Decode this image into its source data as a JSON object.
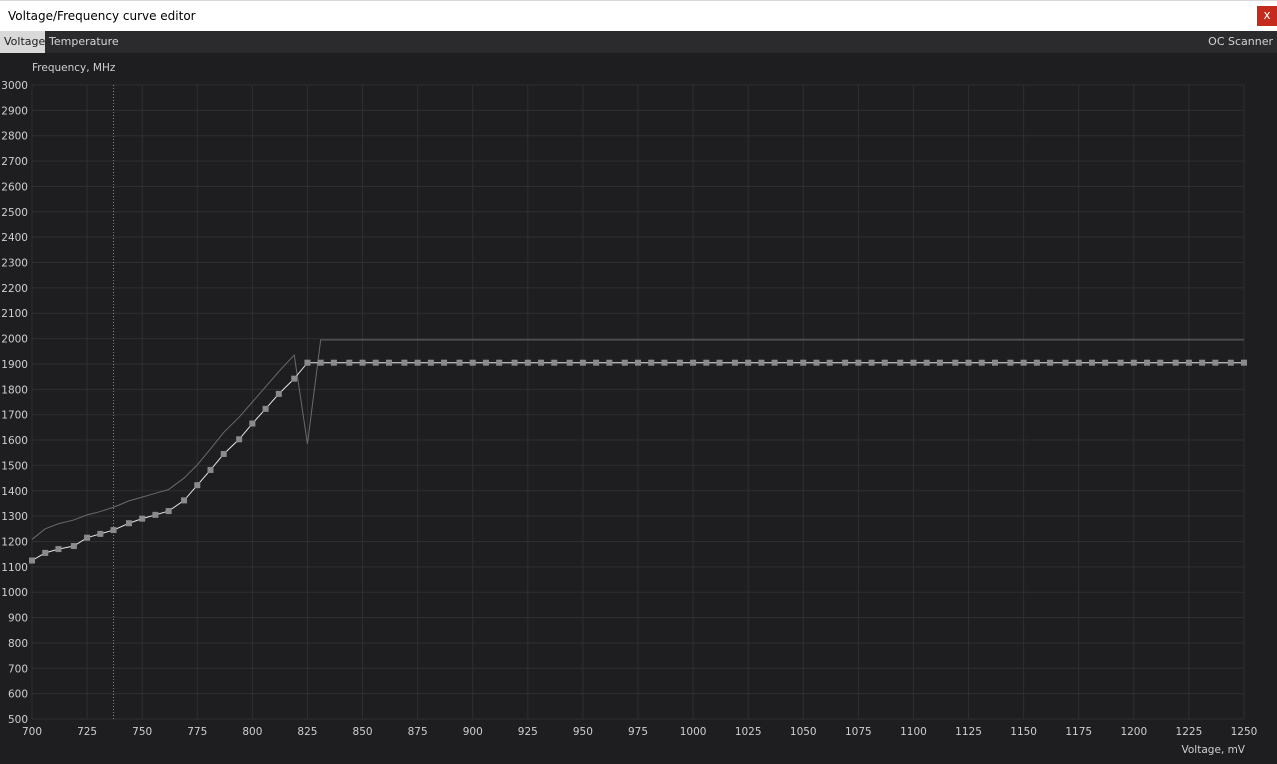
{
  "window": {
    "title": "Voltage/Frequency curve editor",
    "close_glyph": "x"
  },
  "tabs": {
    "voltage": "Voltage",
    "temperature": "Temperature",
    "oc_scanner": "OC Scanner"
  },
  "colors": {
    "background": "#1e1e21",
    "grid": "#2f2f33",
    "curve": "#e6e6e6",
    "points": "#8a8a8a",
    "reference_curve": "#6a6a6a",
    "close_button": "#c42b1c"
  },
  "chart_data": {
    "type": "line",
    "xlabel": "Voltage, mV",
    "ylabel": "Frequency, MHz",
    "xlim": [
      700,
      1250
    ],
    "ylim": [
      500,
      3000
    ],
    "xticks": [
      700,
      725,
      750,
      775,
      800,
      825,
      850,
      875,
      900,
      925,
      950,
      975,
      1000,
      1025,
      1050,
      1075,
      1100,
      1125,
      1150,
      1175,
      1200,
      1225,
      1250
    ],
    "yticks": [
      500,
      600,
      700,
      800,
      900,
      1000,
      1100,
      1200,
      1300,
      1400,
      1500,
      1600,
      1700,
      1800,
      1900,
      2000,
      2100,
      2200,
      2300,
      2400,
      2500,
      2600,
      2700,
      2800,
      2900,
      3000
    ],
    "grid": true,
    "marker_line_voltage": 737,
    "series": [
      {
        "role": "curve",
        "x": [
          700,
          706,
          712,
          719,
          725,
          731,
          737,
          744,
          750,
          756,
          762,
          769,
          775,
          781,
          787,
          794,
          800,
          806,
          812,
          819,
          825,
          831,
          837,
          844,
          850,
          856,
          862,
          869,
          875,
          881,
          887,
          894,
          900,
          906,
          912,
          919,
          925,
          931,
          937,
          944,
          950,
          956,
          962,
          969,
          975,
          981,
          987,
          994,
          1000,
          1006,
          1012,
          1019,
          1025,
          1031,
          1037,
          1044,
          1050,
          1056,
          1062,
          1069,
          1075,
          1081,
          1087,
          1094,
          1100,
          1106,
          1112,
          1119,
          1125,
          1131,
          1137,
          1144,
          1150,
          1156,
          1162,
          1169,
          1175,
          1181,
          1187,
          1194,
          1200,
          1206,
          1212,
          1219,
          1225,
          1231,
          1237,
          1244,
          1250
        ],
        "y": [
          1125,
          1155,
          1170,
          1182,
          1215,
          1230,
          1245,
          1272,
          1290,
          1305,
          1320,
          1362,
          1422,
          1482,
          1545,
          1603,
          1665,
          1723,
          1782,
          1842,
          1905,
          1905,
          1905,
          1905,
          1905,
          1905,
          1905,
          1905,
          1905,
          1905,
          1905,
          1905,
          1905,
          1905,
          1905,
          1905,
          1905,
          1905,
          1905,
          1905,
          1905,
          1905,
          1905,
          1905,
          1905,
          1905,
          1905,
          1905,
          1905,
          1905,
          1905,
          1905,
          1905,
          1905,
          1905,
          1905,
          1905,
          1905,
          1905,
          1905,
          1905,
          1905,
          1905,
          1905,
          1905,
          1905,
          1905,
          1905,
          1905,
          1905,
          1905,
          1905,
          1905,
          1905,
          1905,
          1905,
          1905,
          1905,
          1905,
          1905,
          1905,
          1905,
          1905,
          1905,
          1905,
          1905,
          1905,
          1905,
          1905
        ]
      },
      {
        "role": "reference",
        "x": [
          700,
          706,
          712,
          719,
          725,
          731,
          737,
          744,
          750,
          756,
          762,
          769,
          775,
          781,
          787,
          794,
          800,
          806,
          812,
          819,
          825,
          831,
          1250
        ],
        "y": [
          1208,
          1250,
          1270,
          1285,
          1305,
          1318,
          1335,
          1360,
          1375,
          1390,
          1405,
          1450,
          1502,
          1565,
          1630,
          1690,
          1750,
          1810,
          1870,
          1935,
          1585,
          1995,
          1995
        ]
      }
    ]
  }
}
